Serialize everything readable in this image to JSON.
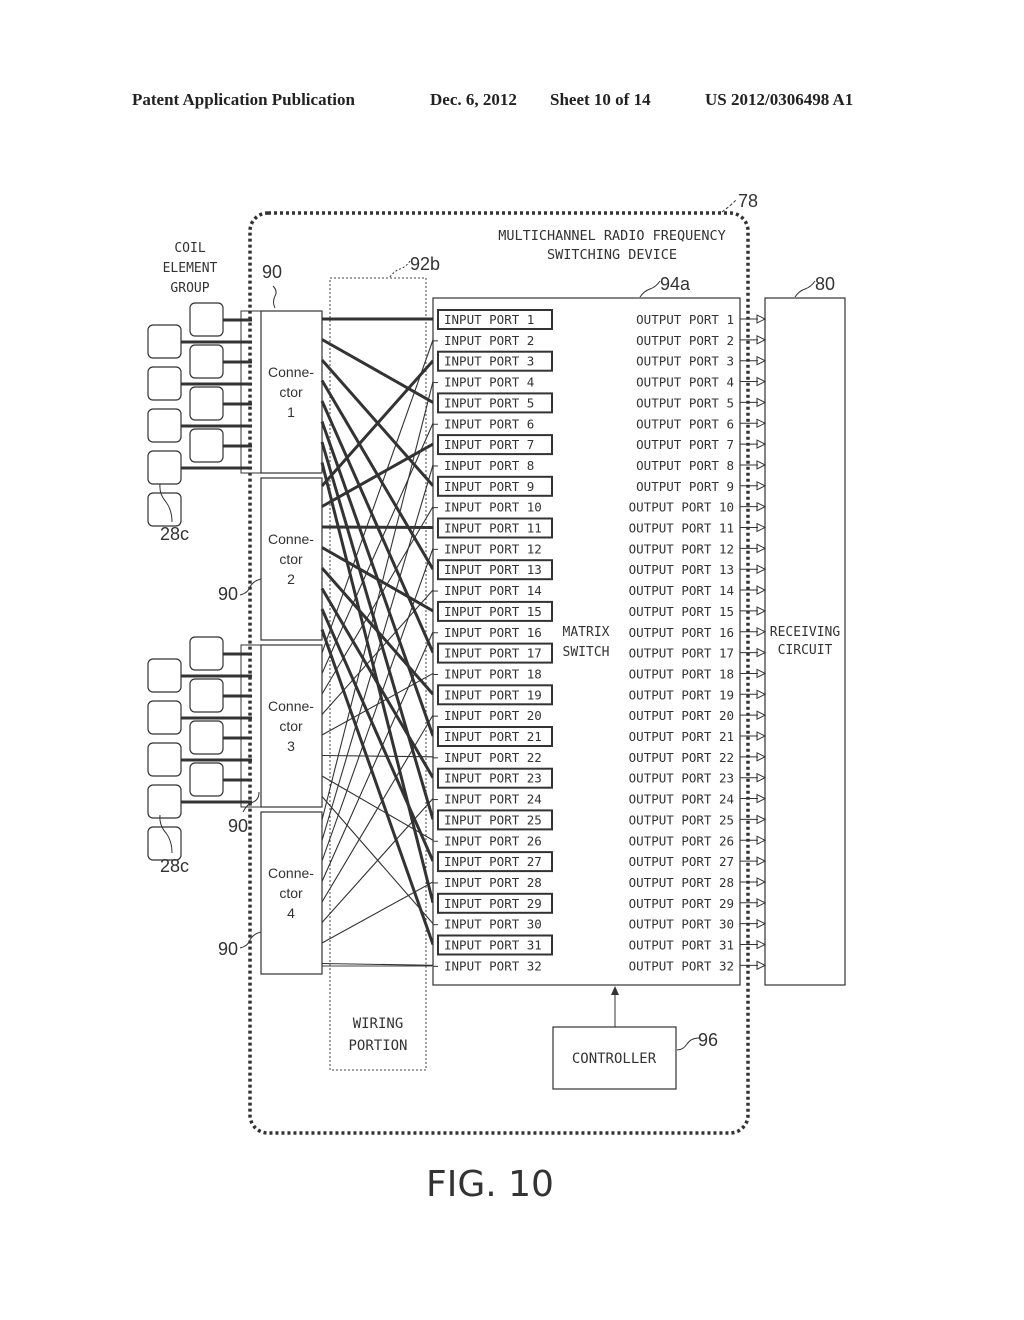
{
  "header": {
    "publication": "Patent Application Publication",
    "date": "Dec. 6, 2012",
    "sheet": "Sheet 10 of 14",
    "number": "US 2012/0306498 A1"
  },
  "figure": {
    "caption": "FIG. 10",
    "device": {
      "ref": "78",
      "title_line1": "MULTICHANNEL RADIO FREQUENCY",
      "title_line2": "SWITCHING DEVICE"
    },
    "coil_group": {
      "label_line1": "COIL",
      "label_line2": "ELEMENT",
      "label_line3": "GROUP",
      "refs": [
        "28c",
        "28c"
      ]
    },
    "connectors": [
      {
        "line1": "Conne-",
        "line2": "ctor",
        "line3": "1",
        "ref": "90"
      },
      {
        "line1": "Conne-",
        "line2": "ctor",
        "line3": "2",
        "ref": "90"
      },
      {
        "line1": "Conne-",
        "line2": "ctor",
        "line3": "3",
        "ref": "90"
      },
      {
        "line1": "Conne-",
        "line2": "ctor",
        "line3": "4",
        "ref": "90"
      }
    ],
    "wiring": {
      "ref": "92b",
      "line1": "WIRING",
      "line2": "PORTION"
    },
    "matrix": {
      "ref": "94a",
      "line1": "MATRIX",
      "line2": "SWITCH"
    },
    "input_ports": [
      "INPUT PORT 1",
      "INPUT PORT 2",
      "INPUT PORT 3",
      "INPUT PORT 4",
      "INPUT PORT 5",
      "INPUT PORT 6",
      "INPUT PORT 7",
      "INPUT PORT 8",
      "INPUT PORT 9",
      "INPUT PORT 10",
      "INPUT PORT 11",
      "INPUT PORT 12",
      "INPUT PORT 13",
      "INPUT PORT 14",
      "INPUT PORT 15",
      "INPUT PORT 16",
      "INPUT PORT 17",
      "INPUT PORT 18",
      "INPUT PORT 19",
      "INPUT PORT 20",
      "INPUT PORT 21",
      "INPUT PORT 22",
      "INPUT PORT 23",
      "INPUT PORT 24",
      "INPUT PORT 25",
      "INPUT PORT 26",
      "INPUT PORT 27",
      "INPUT PORT 28",
      "INPUT PORT 29",
      "INPUT PORT 30",
      "INPUT PORT 31",
      "INPUT PORT 32"
    ],
    "output_ports": [
      "OUTPUT PORT 1",
      "OUTPUT PORT 2",
      "OUTPUT PORT 3",
      "OUTPUT PORT 4",
      "OUTPUT PORT 5",
      "OUTPUT PORT 6",
      "OUTPUT PORT 7",
      "OUTPUT PORT 8",
      "OUTPUT PORT 9",
      "OUTPUT PORT 10",
      "OUTPUT PORT 11",
      "OUTPUT PORT 12",
      "OUTPUT PORT 13",
      "OUTPUT PORT 14",
      "OUTPUT PORT 15",
      "OUTPUT PORT 16",
      "OUTPUT PORT 17",
      "OUTPUT PORT 18",
      "OUTPUT PORT 19",
      "OUTPUT PORT 20",
      "OUTPUT PORT 21",
      "OUTPUT PORT 22",
      "OUTPUT PORT 23",
      "OUTPUT PORT 24",
      "OUTPUT PORT 25",
      "OUTPUT PORT 26",
      "OUTPUT PORT 27",
      "OUTPUT PORT 28",
      "OUTPUT PORT 29",
      "OUTPUT PORT 30",
      "OUTPUT PORT 31",
      "OUTPUT PORT 32"
    ],
    "receiving": {
      "ref": "80",
      "line1": "RECEIVING",
      "line2": "CIRCUIT"
    },
    "controller": {
      "ref": "96",
      "label": "CONTROLLER"
    }
  }
}
